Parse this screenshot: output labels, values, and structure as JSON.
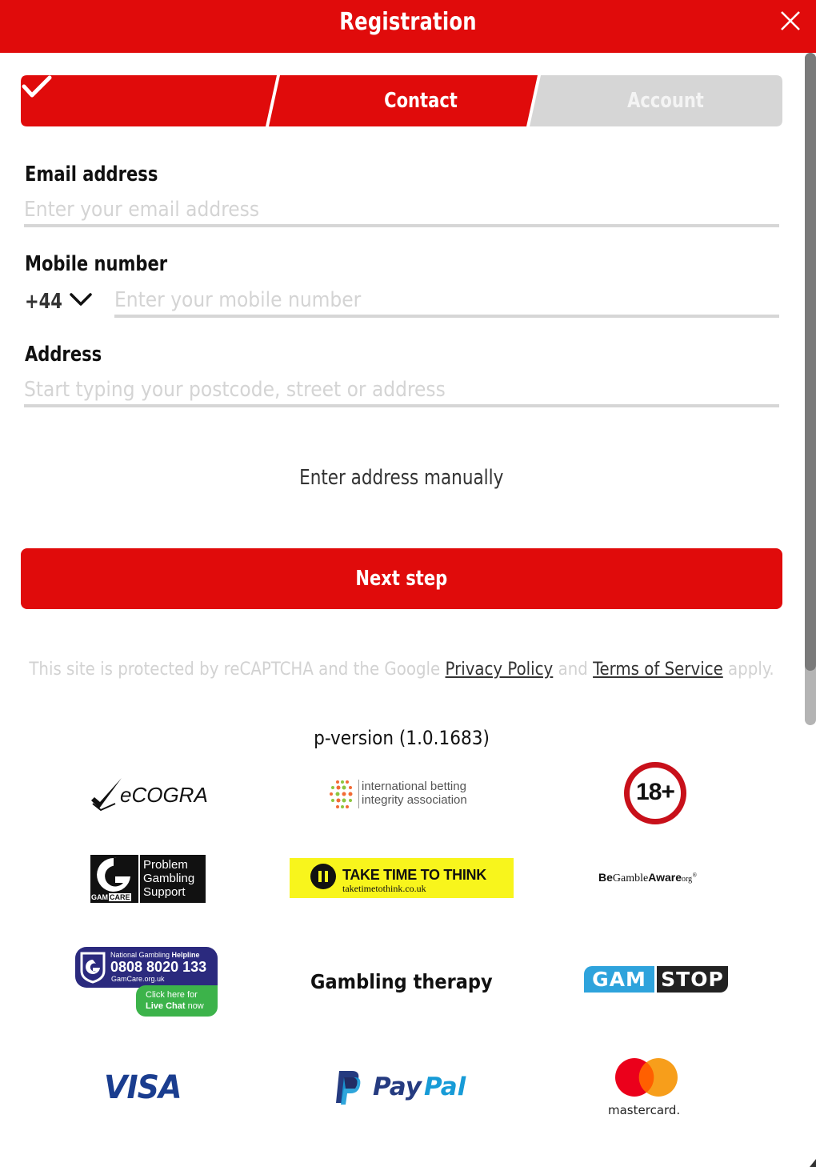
{
  "header": {
    "title": "Registration",
    "close_icon": "close-icon",
    "color": "#e00b0b"
  },
  "stepper": {
    "steps": [
      {
        "label": "",
        "state": "completed",
        "icon": "checkmark-icon"
      },
      {
        "label": "Contact",
        "state": "active"
      },
      {
        "label": "Account",
        "state": "inactive"
      }
    ],
    "active_color": "#e00b0b",
    "inactive_color": "#d6d6d6"
  },
  "form": {
    "email": {
      "label": "Email address",
      "value": "",
      "placeholder": "Enter your email address"
    },
    "mobile": {
      "label": "Mobile number",
      "prefix": "+44",
      "value": "",
      "placeholder": "Enter your mobile number"
    },
    "address": {
      "label": "Address",
      "value": "",
      "placeholder": "Start typing your postcode, street or address"
    },
    "manual_link": "Enter address manually",
    "next_button": "Next step"
  },
  "recaptcha": {
    "text_before": "This site is protected by reCAPTCHA and the Google ",
    "privacy_link": "Privacy Policy",
    "text_middle": " and ",
    "terms_link": "Terms of Service",
    "text_after": " apply."
  },
  "version": "p-version (1.0.1683)",
  "logos": {
    "ecogra": "eCOGRA",
    "ibia_line1": "international betting",
    "ibia_line2": "integrity association",
    "age": "18+",
    "gamcare_lines": [
      "Problem",
      "Gambling",
      "Support"
    ],
    "gamcare_brand_1": "GAM",
    "gamcare_brand_2": "CARE",
    "ttt_title": "TAKE TIME TO THINK",
    "ttt_url": "taketimetothink.co.uk",
    "bga_be": "Be",
    "bga_gamble": "Gamble",
    "bga_aware": "Aware",
    "bga_org": "org",
    "helpline_title_1": "National Gambling ",
    "helpline_title_2": "Helpline",
    "helpline_number": "0808 8020 133",
    "helpline_site": "GamCare.org.uk",
    "helpline_chat_1": "Click here for",
    "helpline_chat_2": "Live Chat",
    "helpline_chat_3": " now",
    "gambling_therapy": "Gambling therapy",
    "gamstop_1": "GAM",
    "gamstop_2": "STOP",
    "visa": "VISA",
    "paypal_1": "Pay",
    "paypal_2": "Pal",
    "mastercard": "mastercard."
  }
}
